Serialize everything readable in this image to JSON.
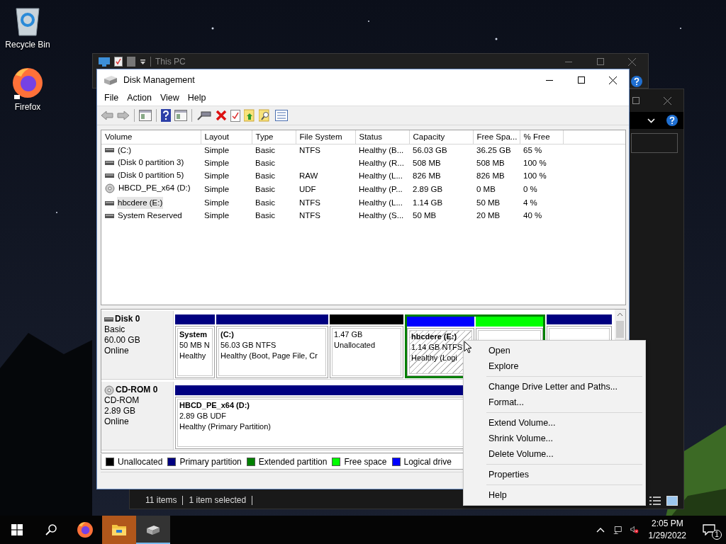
{
  "desktop_icons": [
    {
      "label": "Recycle Bin",
      "kind": "recycle"
    },
    {
      "label": "Firefox",
      "kind": "firefox"
    }
  ],
  "explorer_window": {
    "title": "This PC",
    "status_items": [
      "11 items",
      "1 item selected"
    ]
  },
  "window": {
    "title": "Disk Management",
    "menu": [
      "File",
      "Action",
      "View",
      "Help"
    ]
  },
  "volume_table": {
    "columns": [
      "Volume",
      "Layout",
      "Type",
      "File System",
      "Status",
      "Capacity",
      "Free Spa...",
      "% Free"
    ],
    "rows": [
      {
        "kind": "disk",
        "selected": false,
        "cells": [
          "(C:)",
          "Simple",
          "Basic",
          "NTFS",
          "Healthy (B...",
          "56.03 GB",
          "36.25 GB",
          "65 %"
        ]
      },
      {
        "kind": "disk",
        "selected": false,
        "cells": [
          "(Disk 0 partition 3)",
          "Simple",
          "Basic",
          "",
          "Healthy (R...",
          "508 MB",
          "508 MB",
          "100 %"
        ]
      },
      {
        "kind": "disk",
        "selected": false,
        "cells": [
          "(Disk 0 partition 5)",
          "Simple",
          "Basic",
          "RAW",
          "Healthy (L...",
          "826 MB",
          "826 MB",
          "100 %"
        ]
      },
      {
        "kind": "cd",
        "selected": false,
        "cells": [
          "HBCD_PE_x64 (D:)",
          "Simple",
          "Basic",
          "UDF",
          "Healthy (P...",
          "2.89 GB",
          "0 MB",
          "0 %"
        ]
      },
      {
        "kind": "disk",
        "selected": true,
        "cells": [
          "hbcdere (E:)",
          "Simple",
          "Basic",
          "NTFS",
          "Healthy (L...",
          "1.14 GB",
          "50 MB",
          "4 %"
        ]
      },
      {
        "kind": "disk",
        "selected": false,
        "cells": [
          "System Reserved",
          "Simple",
          "Basic",
          "NTFS",
          "Healthy (S...",
          "50 MB",
          "20 MB",
          "40 %"
        ]
      }
    ]
  },
  "disks": [
    {
      "name": "Disk 0",
      "kind": "disk",
      "info": [
        "Basic",
        "60.00 GB",
        "Online"
      ],
      "partitions": [
        {
          "kind": "primary",
          "selected": false,
          "lines": [
            "**System**",
            "50 MB N",
            "Healthy"
          ]
        },
        {
          "kind": "primary",
          "selected": false,
          "lines": [
            "**(C:)**",
            "56.03 GB NTFS",
            "Healthy (Boot, Page File, Cr"
          ]
        },
        {
          "kind": "unallocated",
          "selected": false,
          "lines": [
            "1.47 GB",
            "Unallocated"
          ]
        },
        {
          "kind": "extended",
          "selected": false,
          "children": [
            {
              "kind": "logical",
              "selected": true,
              "lines": [
                "**hbcdere  (E:)**",
                "1.14 GB NTFS",
                "Healthy (Logi"
              ]
            },
            {
              "kind": "free",
              "selected": false
            }
          ]
        },
        {
          "kind": "primary",
          "selected": false
        }
      ]
    },
    {
      "name": "CD-ROM 0",
      "kind": "cd",
      "info": [
        "CD-ROM",
        "2.89 GB",
        "Online"
      ],
      "partitions": [
        {
          "kind": "primary",
          "selected": false,
          "lines": [
            "**HBCD_PE_x64  (D:)**",
            "2.89 GB UDF",
            "Healthy (Primary Partition)"
          ]
        }
      ]
    }
  ],
  "legend": [
    {
      "label": "Unallocated",
      "kind": "unallocated",
      "color": "#000000"
    },
    {
      "label": "Primary partition",
      "kind": "primary",
      "color": "#000080"
    },
    {
      "label": "Extended partition",
      "kind": "extended",
      "color": "#008000"
    },
    {
      "label": "Free space",
      "kind": "free",
      "color": "#00ff00"
    },
    {
      "label": "Logical drive",
      "kind": "logical",
      "color": "#0000ff"
    }
  ],
  "context_menu": {
    "items": [
      {
        "kind": "item",
        "label": "Open"
      },
      {
        "kind": "item",
        "label": "Explore"
      },
      {
        "kind": "separator"
      },
      {
        "kind": "item",
        "label": "Change Drive Letter and Paths..."
      },
      {
        "kind": "item",
        "label": "Format..."
      },
      {
        "kind": "separator"
      },
      {
        "kind": "item",
        "label": "Extend Volume..."
      },
      {
        "kind": "item",
        "label": "Shrink Volume..."
      },
      {
        "kind": "item",
        "label": "Delete Volume..."
      },
      {
        "kind": "separator"
      },
      {
        "kind": "item",
        "label": "Properties"
      },
      {
        "kind": "separator"
      },
      {
        "kind": "item",
        "label": "Help"
      }
    ]
  },
  "taskbar": {
    "apps": [
      {
        "kind": "firefox",
        "active": false,
        "flashing": false
      },
      {
        "kind": "explorer",
        "active": false,
        "flashing": true
      },
      {
        "kind": "diskmgmt",
        "active": true,
        "flashing": false
      }
    ],
    "time": "2:05 PM",
    "date": "1/29/2022",
    "notification_count": "1"
  }
}
